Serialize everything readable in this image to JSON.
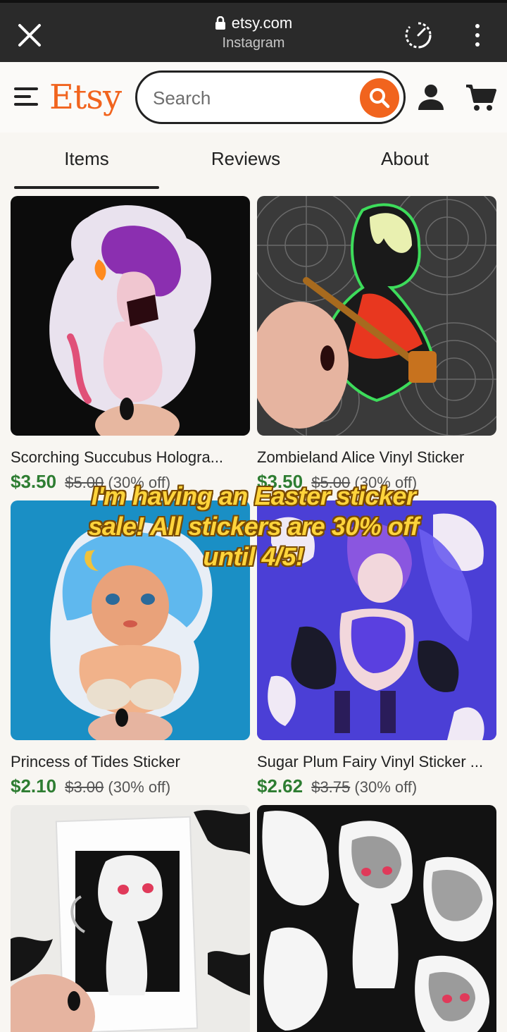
{
  "browser": {
    "domain": "etsy.com",
    "source": "Instagram"
  },
  "header": {
    "logo_text": "Etsy",
    "search_placeholder": "Search",
    "accent_color": "#f1641e"
  },
  "tabs": [
    {
      "label": "Items",
      "active": true
    },
    {
      "label": "Reviews",
      "active": false
    },
    {
      "label": "About",
      "active": false
    }
  ],
  "listings": [
    {
      "title": "Scorching Succubus Hologra...",
      "price": "$3.50",
      "original_price": "$5.00",
      "discount": "(30% off)"
    },
    {
      "title": "Zombieland Alice Vinyl Sticker",
      "price": "$3.50",
      "original_price": "$5.00",
      "discount": "(30% off)"
    },
    {
      "title": "Princess of Tides Sticker",
      "price": "$2.10",
      "original_price": "$3.00",
      "discount": "(30% off)"
    },
    {
      "title": "Sugar Plum Fairy Vinyl Sticker ...",
      "price": "$2.62",
      "original_price": "$3.75",
      "discount": "(30% off)"
    },
    {
      "title": "",
      "price": "",
      "original_price": "",
      "discount": ""
    },
    {
      "title": "",
      "price": "",
      "original_price": "",
      "discount": ""
    }
  ],
  "overlay": {
    "line1": "I'm having an Easter sticker",
    "line2": "sale! All stickers are 30% off",
    "line3": "until 4/5!"
  }
}
